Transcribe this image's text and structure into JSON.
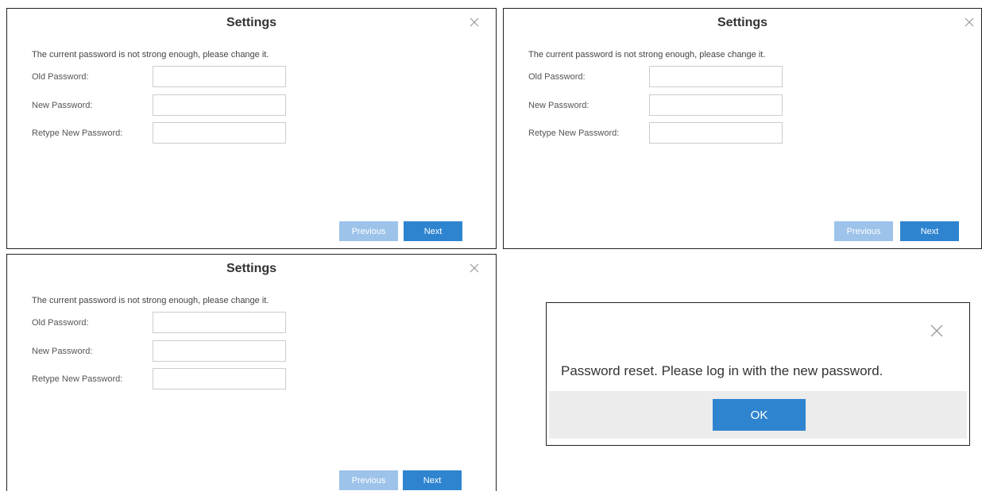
{
  "dialog": {
    "title": "Settings",
    "notice": "The current password is not strong enough, please change it.",
    "old_password_label": "Old Password:",
    "new_password_label": "New Password:",
    "retype_password_label": "Retype New Password:",
    "old_password_value": "",
    "new_password_value": "",
    "retype_password_value": "",
    "previous_label": "Previous",
    "next_label": "Next",
    "close_icon": "close-icon"
  },
  "confirm": {
    "message": "Password reset. Please log in with the new password.",
    "ok_label": "OK",
    "close_icon": "close-icon"
  },
  "colors": {
    "primary": "#2f84d0",
    "primary_disabled": "#9dc3ea",
    "footer_bg": "#ececec"
  }
}
